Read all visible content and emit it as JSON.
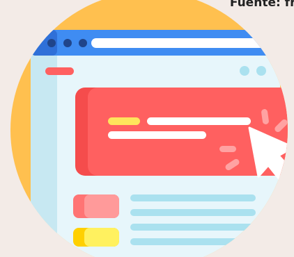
{
  "header": {
    "source_label": "Fuente: fre"
  },
  "colors": {
    "background": "#f3ebe7",
    "sun_circle": "#ffc04f",
    "window_bar": "#3f8cf2",
    "window_bar_dark": "#2f70d8",
    "window_bg": "#e7f6fb",
    "window_sidebar": "#c7e8f2",
    "banner": "#ff6060",
    "banner_dark": "#f54c4c",
    "highlight": "#ffe45c",
    "line_light": "#aae1ef",
    "white": "#ffffff"
  },
  "icons": {
    "cursor": "cursor-icon",
    "click_spark": "click-spark-icon"
  }
}
